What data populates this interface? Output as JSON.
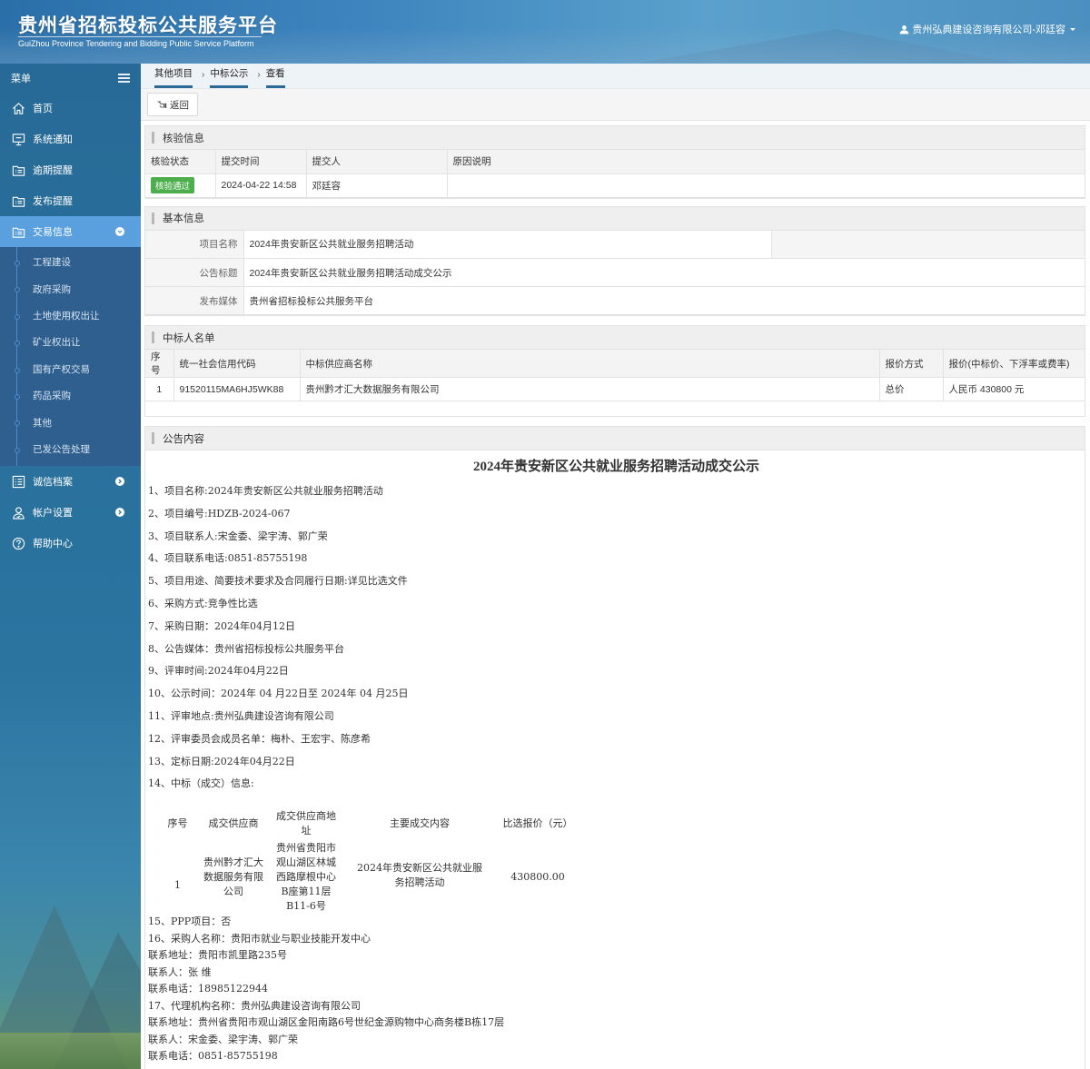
{
  "header": {
    "title_cn": "贵州省招标投标公共服务平台",
    "title_en": "GuiZhou Province Tendering and Bidding Public Service Platform",
    "user": "贵州弘典建设咨询有限公司-邓廷容"
  },
  "sidebar": {
    "menu_label": "菜单",
    "items": [
      {
        "label": "首页",
        "icon": "home-icon"
      },
      {
        "label": "系统通知",
        "icon": "monitor-icon"
      },
      {
        "label": "逾期提醒",
        "icon": "folder-list-icon"
      },
      {
        "label": "发布提醒",
        "icon": "folder-list-icon"
      },
      {
        "label": "交易信息",
        "icon": "folder-list-icon",
        "active": true,
        "expanded": true
      }
    ],
    "sub_items": [
      "工程建设",
      "政府采购",
      "土地使用权出让",
      "矿业权出让",
      "国有产权交易",
      "药品采购",
      "其他",
      "已发公告处理"
    ],
    "items_after": [
      {
        "label": "诚信档案",
        "icon": "list-icon"
      },
      {
        "label": "帐户设置",
        "icon": "user-icon"
      },
      {
        "label": "帮助中心",
        "icon": "help-icon"
      }
    ]
  },
  "breadcrumb": [
    "其他项目",
    "中标公示",
    "查看"
  ],
  "toolbar": {
    "back_label": "返回"
  },
  "verify": {
    "title": "核验信息",
    "headers": [
      "核验状态",
      "提交时间",
      "提交人",
      "原因说明"
    ],
    "row": {
      "status": "核验通过",
      "time": "2024-04-22 14:58",
      "submitter": "邓廷容",
      "reason": ""
    },
    "status_color": "#4cae4c"
  },
  "basic": {
    "title": "基本信息",
    "rows": [
      {
        "label": "项目名称",
        "value": "2024年贵安新区公共就业服务招聘活动"
      },
      {
        "label": "公告标题",
        "value": "2024年贵安新区公共就业服务招聘活动成交公示"
      },
      {
        "label": "发布媒体",
        "value": "贵州省招标投标公共服务平台"
      }
    ]
  },
  "winners": {
    "title": "中标人名单",
    "headers": [
      "序号",
      "统一社会信用代码",
      "中标供应商名称",
      "报价方式",
      "报价(中标价、下浮率或费率)"
    ],
    "rows": [
      {
        "no": "1",
        "code": "91520115MA6HJ5WK88",
        "name": "贵州黔才汇大数据服务有限公司",
        "method": "总价",
        "price": "人民币 430800 元"
      }
    ]
  },
  "notice": {
    "title": "公告内容",
    "heading": "2024年贵安新区公共就业服务招聘活动成交公示",
    "lines": [
      "1、项目名称:2024年贵安新区公共就业服务招聘活动",
      "2、项目编号:HDZB-2024-067",
      "3、项目联系人:宋金委、梁宇涛、郭广荣",
      "4、项目联系电话:0851-85755198",
      "5、项目用途、简要技术要求及合同履行日期:详见比选文件",
      "6、采购方式:竞争性比选",
      "7、采购日期：2024年04月12日",
      "8、公告媒体：贵州省招标投标公共服务平台",
      "9、评审时间:2024年04月22日",
      "10、公示时间：2024年 04 月22日至 2024年 04 月25日",
      "11、评审地点:贵州弘典建设咨询有限公司",
      "12、评审委员会成员名单：梅朴、王宏宇、陈彦希",
      "13、定标日期:2024年04月22日",
      "14、中标（成交）信息:"
    ],
    "deal_headers": [
      "序号",
      "成交供应商",
      "成交供应商地址",
      "主要成交内容",
      "比选报价（元）"
    ],
    "deal_row": {
      "no": "1",
      "supplier": "贵州黔才汇大数据服务有限公司",
      "address": "贵州省贵阳市观山湖区林城西路摩根中心B座第11层B11-6号",
      "content": "2024年贵安新区公共就业服务招聘活动",
      "price": "430800.00"
    },
    "tail_lines": [
      "15、PPP项目：否",
      "16、采购人名称：贵阳市就业与职业技能开发中心",
      "联系地址：贵阳市凯里路235号",
      "联系人：张 维",
      "联系电话：18985122944",
      "17、代理机构名称：贵州弘典建设咨询有限公司",
      "联系地址：贵州省贵阳市观山湖区金阳南路6号世纪金源购物中心商务楼B栋17层",
      "联系人：宋金委、梁宇涛、郭广荣",
      "联系电话：0851-85755198"
    ]
  }
}
